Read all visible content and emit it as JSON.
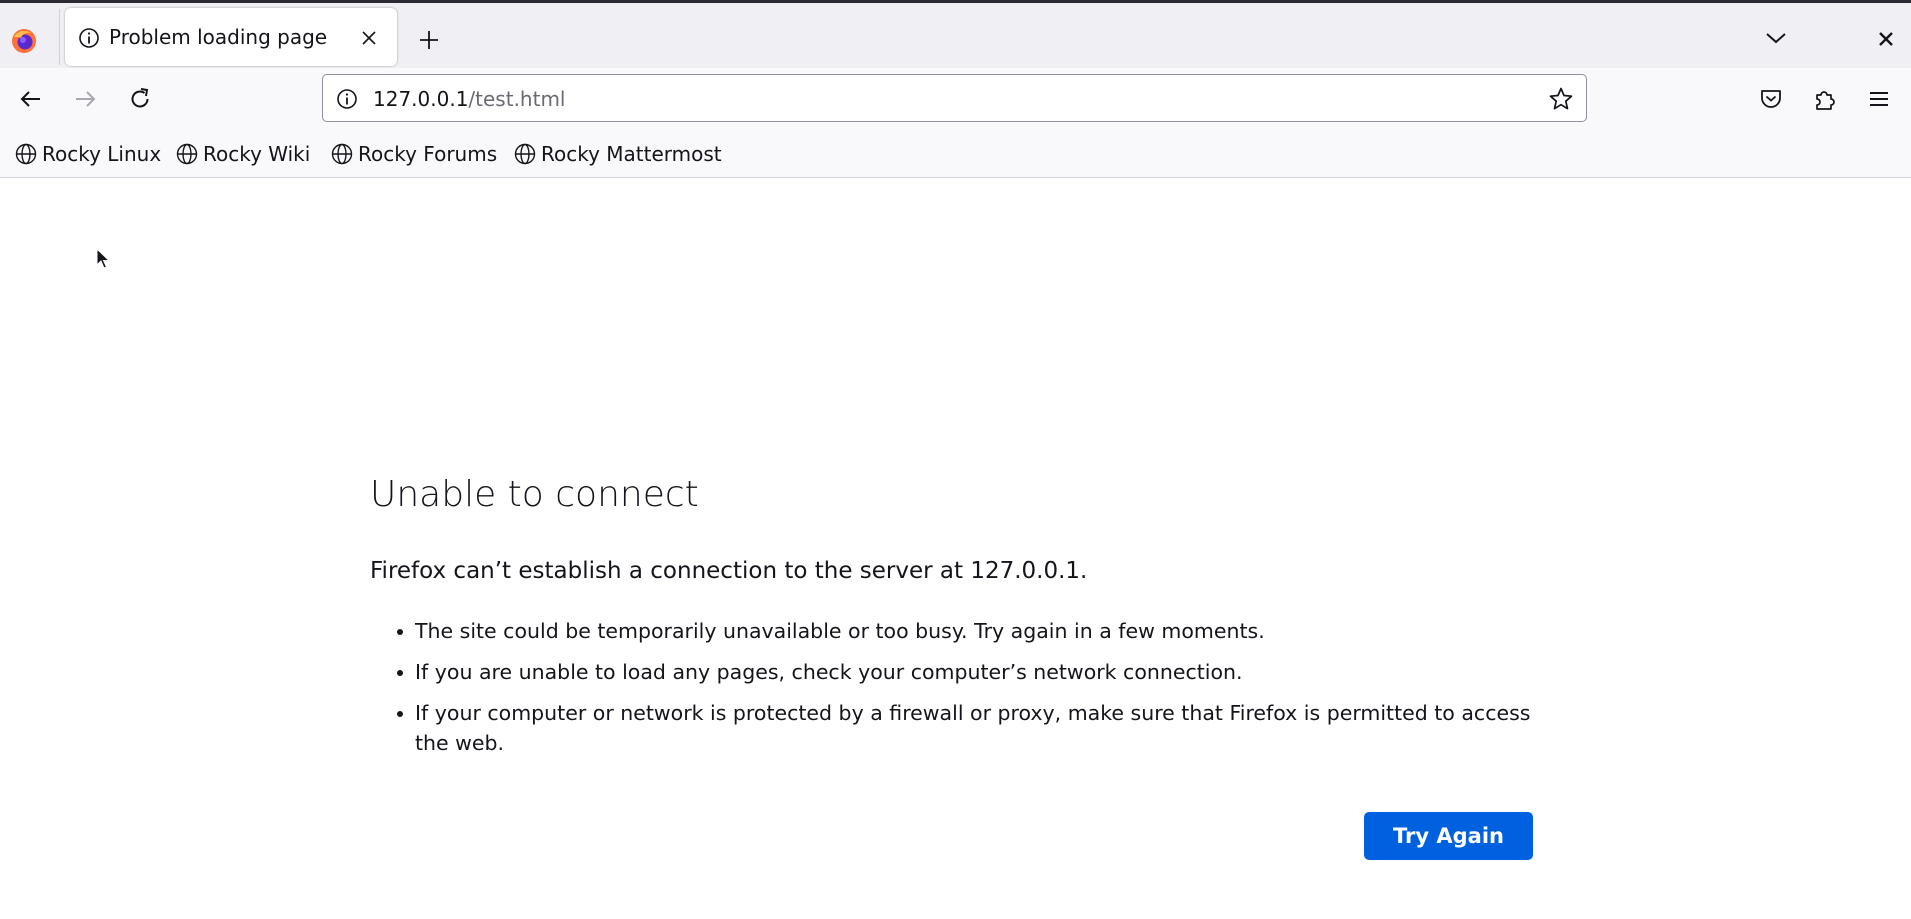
{
  "browser": {
    "tab": {
      "title": "Problem loading page",
      "icon": "info-icon"
    },
    "url": {
      "host": "127.0.0.1",
      "path": "/test.html"
    },
    "bookmarks": [
      {
        "label": "Rocky Linux"
      },
      {
        "label": "Rocky Wiki"
      },
      {
        "label": "Rocky Forums"
      },
      {
        "label": "Rocky Mattermost"
      }
    ]
  },
  "error_page": {
    "title": "Unable to connect",
    "description": "Firefox can’t establish a connection to the server at 127.0.0.1.",
    "bullets": [
      "The site could be temporarily unavailable or too busy. Try again in a few moments.",
      "If you are unable to load any pages, check your computer’s network connection.",
      "If your computer or network is protected by a firewall or proxy, make sure that Firefox is permitted to access the web."
    ],
    "button_label": "Try Again"
  },
  "colors": {
    "accent": "#0061e0",
    "tabstrip_bg": "#f0f0f4",
    "toolbar_bg": "#f9f9fb",
    "text": "#15141a"
  }
}
